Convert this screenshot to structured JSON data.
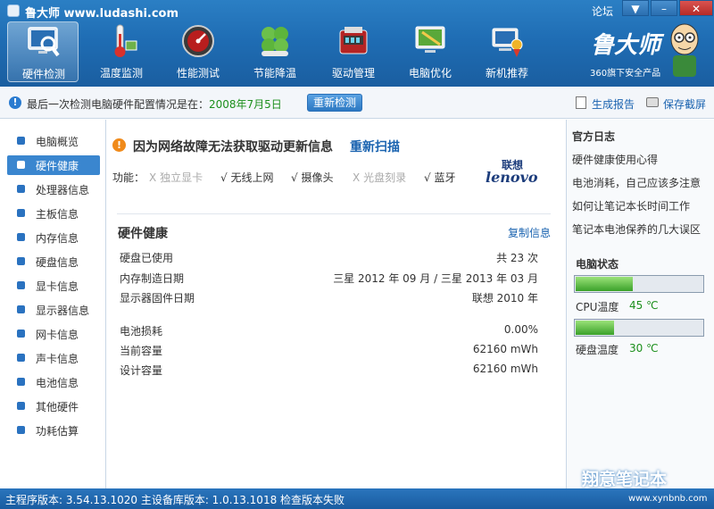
{
  "window": {
    "title": "鲁大师 www.ludashi.com",
    "forum": "论坛",
    "menu_btn": "▼",
    "minimize_btn": "–",
    "close_btn": "✕"
  },
  "nav": [
    {
      "label": "硬件检测",
      "icon": "monitor-magnifier-icon"
    },
    {
      "label": "温度监测",
      "icon": "thermometer-icon"
    },
    {
      "label": "性能测试",
      "icon": "speedometer-icon"
    },
    {
      "label": "节能降温",
      "icon": "clover-icon"
    },
    {
      "label": "驱动管理",
      "icon": "driver-toolbox-icon"
    },
    {
      "label": "电脑优化",
      "icon": "broom-monitor-icon"
    },
    {
      "label": "新机推荐",
      "icon": "award-pc-icon"
    }
  ],
  "brand": {
    "name": "鲁大师",
    "subtitle": "360旗下安全产品"
  },
  "infobar": {
    "text": "最后一次检测电脑硬件配置情况是在：",
    "date": "2008年7月5日",
    "rescan_button": "重新检测",
    "report": "生成报告",
    "screenshot": "保存截屏"
  },
  "sidebar": {
    "items": [
      {
        "label": "电脑概览"
      },
      {
        "label": "硬件健康",
        "active": true
      },
      {
        "label": "处理器信息"
      },
      {
        "label": "主板信息"
      },
      {
        "label": "内存信息"
      },
      {
        "label": "硬盘信息"
      },
      {
        "label": "显卡信息"
      },
      {
        "label": "显示器信息"
      },
      {
        "label": "网卡信息"
      },
      {
        "label": "声卡信息"
      },
      {
        "label": "电池信息"
      },
      {
        "label": "其他硬件"
      },
      {
        "label": "功耗估算"
      }
    ]
  },
  "main": {
    "warning": "因为网络故障无法获取驱动更新信息",
    "warning_action": "重新扫描",
    "functions_label": "功能：",
    "functions": [
      {
        "mark": "X",
        "label": "独立显卡",
        "enabled": false
      },
      {
        "mark": "√",
        "label": "无线上网",
        "enabled": true
      },
      {
        "mark": "√",
        "label": "摄像头",
        "enabled": true
      },
      {
        "mark": "X",
        "label": "光盘刻录",
        "enabled": false
      },
      {
        "mark": "√",
        "label": "蓝牙",
        "enabled": true
      }
    ],
    "vendor_cn": "联想",
    "vendor_en": "lenovo",
    "section_title": "硬件健康",
    "copy_link": "复制信息",
    "rows": [
      {
        "label": "硬盘已使用",
        "value": "共 23 次"
      },
      {
        "label": "内存制造日期",
        "value": "三星 2012 年 09 月 / 三星 2013 年 03 月"
      },
      {
        "label": "显示器固件日期",
        "value": "联想 2010 年"
      },
      {
        "label": "电池损耗",
        "value": "0.00%"
      },
      {
        "label": "当前容量",
        "value": "62160 mWh"
      },
      {
        "label": "设计容量",
        "value": "62160 mWh"
      }
    ]
  },
  "right": {
    "log_title": "官方日志",
    "logs": [
      "硬件健康使用心得",
      "电池消耗，自己应该多注意",
      "如何让笔记本长时间工作",
      "笔记本电池保养的几大误区"
    ],
    "status_title": "电脑状态",
    "cpu_label": "CPU温度",
    "cpu_temp": "45 ℃",
    "cpu_level": 0.45,
    "disk_label": "硬盘温度",
    "disk_temp": "30 ℃",
    "disk_level": 0.3
  },
  "statusbar": {
    "text": "主程序版本: 3.54.13.1020   主设备库版本: 1.0.13.1018    检查版本失败"
  },
  "watermark": {
    "text": "翔意笔记本",
    "url": "www.xynbnb.com"
  },
  "colors": {
    "header_blue": "#1f6db4",
    "accent_link": "#1a63b0",
    "date_green": "#1c8f1c",
    "warning_orange": "#f08a1a"
  }
}
